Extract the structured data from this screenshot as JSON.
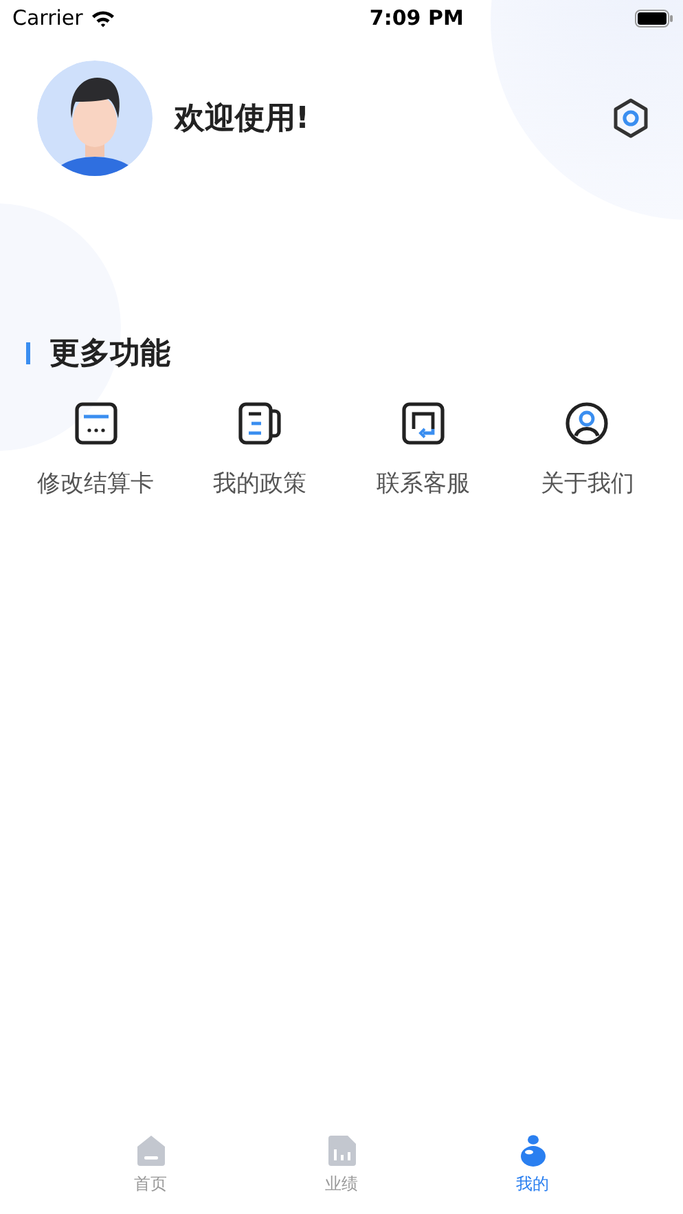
{
  "status_bar": {
    "carrier": "Carrier",
    "time": "7:09 PM"
  },
  "profile": {
    "greeting": "欢迎使用!"
  },
  "section": {
    "title": "更多功能"
  },
  "features": [
    {
      "kind": "card",
      "label": "修改结算卡"
    },
    {
      "kind": "document",
      "label": "我的政策"
    },
    {
      "kind": "service",
      "label": "联系客服"
    },
    {
      "kind": "person",
      "label": "关于我们"
    }
  ],
  "tabs": [
    {
      "kind": "home",
      "label": "首页",
      "selected": false
    },
    {
      "kind": "chart",
      "label": "业绩",
      "selected": false
    },
    {
      "kind": "me",
      "label": "我的",
      "selected": true
    }
  ]
}
